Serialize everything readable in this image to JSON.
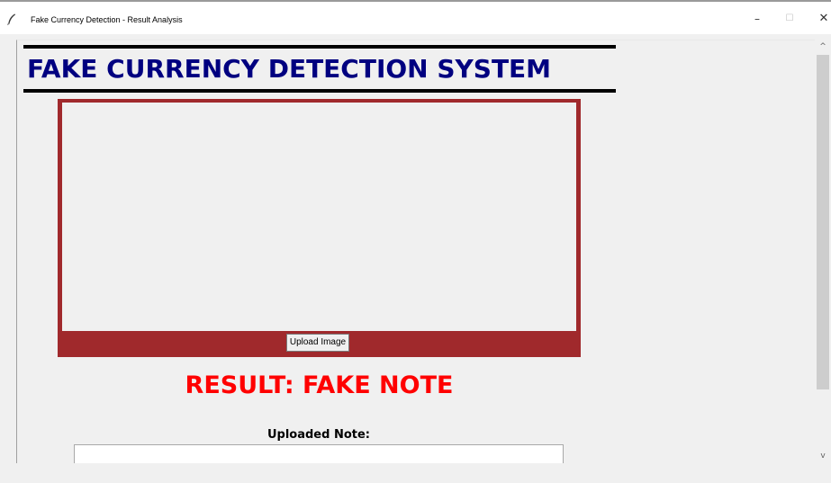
{
  "window": {
    "title": "Fake Currency Detection - Result Analysis",
    "app_icon": "feather-icon",
    "controls": {
      "minimize_glyph": "–",
      "maximize_glyph": "☐",
      "close_glyph": "✕"
    }
  },
  "header": {
    "title": "FAKE CURRENCY DETECTION SYSTEM"
  },
  "image_panel": {
    "upload_button_label": "Upload Image"
  },
  "result": {
    "text": "RESULT: FAKE NOTE",
    "color": "#ff0000"
  },
  "uploaded_note": {
    "label": "Uploaded Note:",
    "value": ""
  },
  "scrollbar": {
    "up_glyph": "^",
    "down_glyph": "v"
  },
  "colors": {
    "title": "#000080",
    "panel_border": "#a0292c",
    "background": "#f0f0f0"
  }
}
